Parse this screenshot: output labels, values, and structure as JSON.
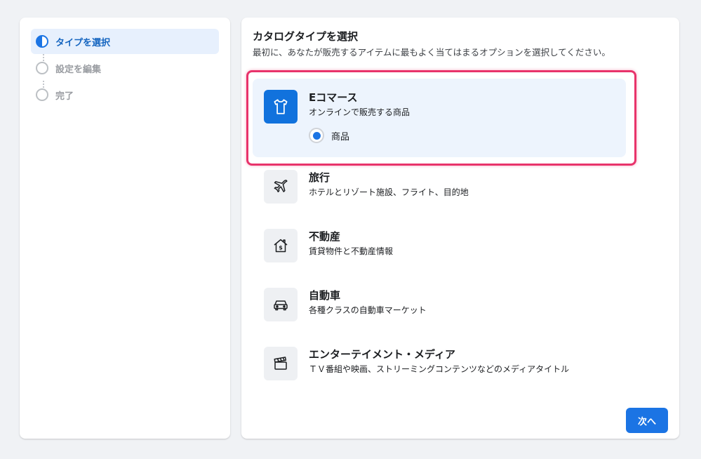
{
  "stepper": {
    "steps": [
      {
        "label": "タイプを選択",
        "state": "active"
      },
      {
        "label": "設定を編集",
        "state": "inactive"
      },
      {
        "label": "完了",
        "state": "inactive"
      }
    ]
  },
  "main": {
    "title": "カタログタイプを選択",
    "subtitle": "最初に、あなたが販売するアイテムに最もよく当てはまるオプションを選択してください。",
    "options": [
      {
        "title": "Eコマース",
        "description": "オンラインで販売する商品",
        "icon": "tshirt-icon",
        "selected": true,
        "radio_label": "商品"
      },
      {
        "title": "旅行",
        "description": "ホテルとリゾート施設、フライト、目的地",
        "icon": "airplane-icon",
        "selected": false
      },
      {
        "title": "不動産",
        "description": "賃貸物件と不動産情報",
        "icon": "house-dollar-icon",
        "selected": false
      },
      {
        "title": "自動車",
        "description": "各種クラスの自動車マーケット",
        "icon": "car-icon",
        "selected": false
      },
      {
        "title": "エンターテイメント・メディア",
        "description": "ＴＶ番組や映画、ストリーミングコンテンツなどのメディアタイトル",
        "icon": "clapperboard-icon",
        "selected": false
      }
    ],
    "next_label": "次へ"
  },
  "colors": {
    "accent": "#1b74e4",
    "highlight": "#e8336b",
    "selected_bg": "#edf4fd"
  }
}
